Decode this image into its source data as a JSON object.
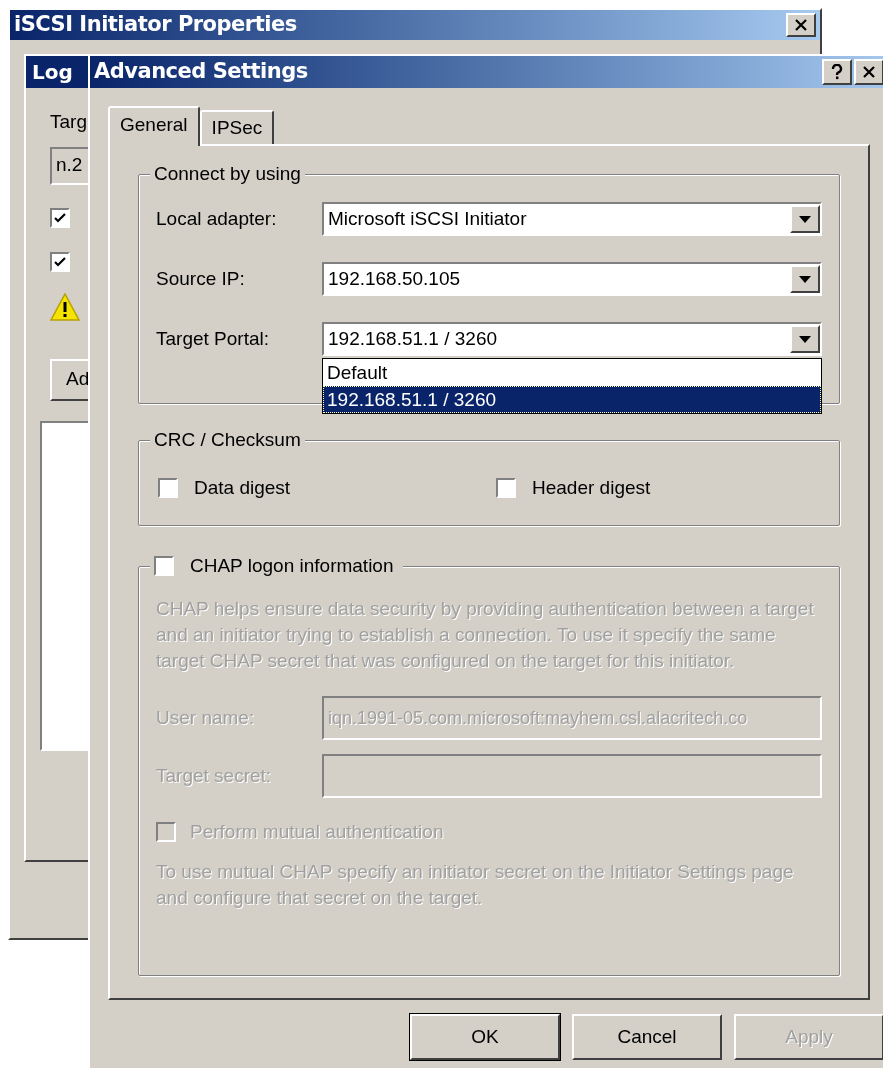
{
  "back_window": {
    "title": "iSCSI Initiator Properties",
    "inner_title": "Log",
    "label": "Targ",
    "field_value": "n.2",
    "checkboxes": [
      {
        "checked": true
      },
      {
        "checked": true
      }
    ],
    "button": "Ad"
  },
  "dialog": {
    "title": "Advanced Settings",
    "tabs": [
      {
        "label": "General",
        "selected": true
      },
      {
        "label": "IPSec",
        "selected": false
      }
    ],
    "connect_group": {
      "title": "Connect by using",
      "rows": [
        {
          "label": "Local adapter:",
          "value": "Microsoft iSCSI Initiator"
        },
        {
          "label": "Source IP:",
          "value": "192.168.50.105"
        },
        {
          "label": "Target Portal:",
          "value": "192.168.51.1 / 3260",
          "options": [
            {
              "text": "Default",
              "selected": false
            },
            {
              "text": "192.168.51.1 / 3260",
              "selected": true
            }
          ]
        }
      ]
    },
    "crc_group": {
      "title": "CRC / Checksum",
      "options": [
        {
          "label": "Data digest",
          "checked": false
        },
        {
          "label": "Header digest",
          "checked": false
        }
      ]
    },
    "chap_group": {
      "label": "CHAP logon information",
      "checked": false,
      "description": "CHAP helps ensure data security by providing authentication between a target and an initiator trying to establish a connection. To use it specify the same target CHAP secret that was configured on the target for this initiator.",
      "fields": [
        {
          "label": "User name:",
          "value": "iqn.1991-05.com.microsoft:mayhem.csl.alacritech.co"
        },
        {
          "label": "Target secret:"
        }
      ],
      "mutual": {
        "label": "Perform mutual authentication",
        "checked": false
      },
      "note": "To use mutual CHAP specify an initiator secret on the Initiator Settings page and configure that secret on the target."
    },
    "buttons": [
      {
        "label": "OK",
        "default": true,
        "disabled": false
      },
      {
        "label": "Cancel",
        "default": false,
        "disabled": false
      },
      {
        "label": "Apply",
        "default": false,
        "disabled": true
      }
    ]
  }
}
